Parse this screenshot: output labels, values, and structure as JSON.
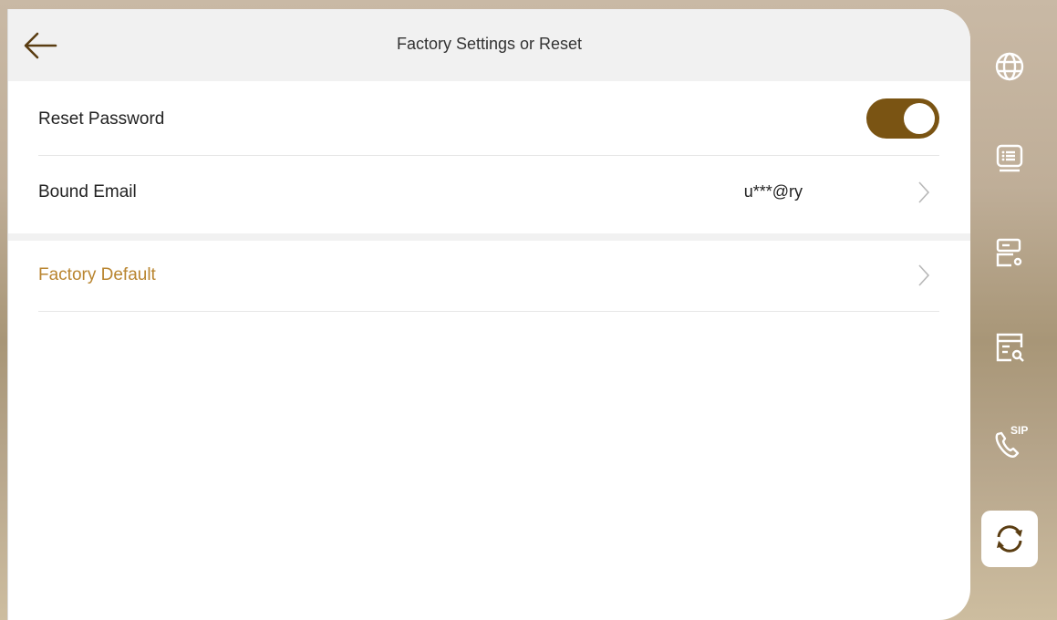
{
  "header": {
    "title": "Factory Settings or Reset",
    "back_icon": "back-arrow-icon"
  },
  "rows": {
    "reset_password": {
      "label": "Reset Password",
      "toggle_on": true
    },
    "bound_email": {
      "label": "Bound Email",
      "value": "u***@ry"
    },
    "factory_default": {
      "label": "Factory Default"
    }
  },
  "sidebar": {
    "items": [
      {
        "icon": "globe-icon"
      },
      {
        "icon": "list-icon"
      },
      {
        "icon": "server-settings-icon"
      },
      {
        "icon": "log-search-icon"
      },
      {
        "icon": "sip-phone-icon",
        "text": "SIP"
      },
      {
        "icon": "refresh-icon",
        "active": true
      }
    ]
  },
  "colors": {
    "accent": "#b98530",
    "toggle_on": "#7a5413",
    "header_bg": "#f1f1f1"
  }
}
